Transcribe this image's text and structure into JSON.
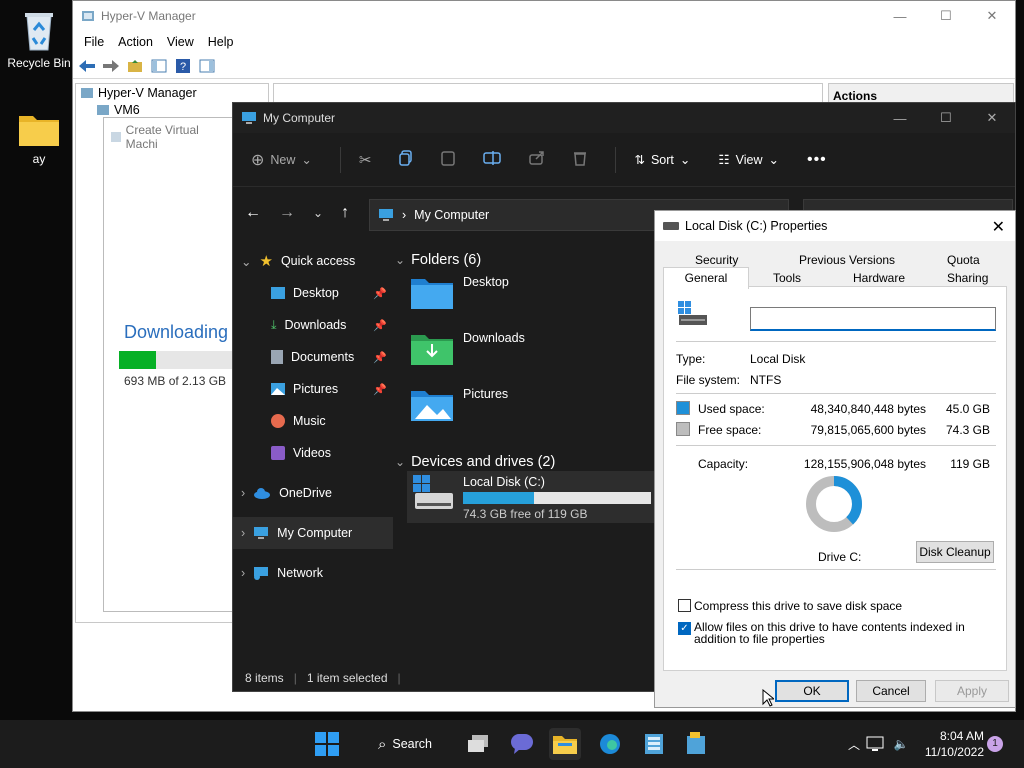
{
  "desktop": {
    "icons": [
      {
        "label": "Recycle Bin"
      },
      {
        "label": "ay"
      }
    ]
  },
  "hyperv": {
    "title": "Hyper-V Manager",
    "menu": [
      "File",
      "Action",
      "View",
      "Help"
    ],
    "tree": {
      "root": "Hyper-V Manager",
      "vm": "VM6"
    },
    "actions_header": "Actions",
    "wizard": {
      "title": "Create Virtual Machi",
      "status": "Downloading",
      "progress": 0.32,
      "size": "693 MB of 2.13 GB"
    }
  },
  "explorer": {
    "title": "My Computer",
    "commands": {
      "new": "New",
      "sort": "Sort",
      "view": "View"
    },
    "address": "My Computer",
    "nav": {
      "quick_access": "Quick access",
      "items": [
        "Desktop",
        "Downloads",
        "Documents",
        "Pictures",
        "Music",
        "Videos"
      ],
      "onedrive": "OneDrive",
      "my_computer": "My Computer",
      "network": "Network"
    },
    "folders_header": "Folders (6)",
    "folders": [
      "Desktop",
      "Downloads",
      "Pictures"
    ],
    "drives_header": "Devices and drives (2)",
    "drive": {
      "name": "Local Disk (C:)",
      "free": "74.3 GB free of 119 GB",
      "used_fraction": 0.38
    },
    "status": {
      "count": "8 items",
      "selected": "1 item selected"
    }
  },
  "properties": {
    "title": "Local Disk (C:) Properties",
    "tabs_row1": [
      "Security",
      "Previous Versions",
      "Quota"
    ],
    "tabs_row2": [
      "General",
      "Tools",
      "Hardware",
      "Sharing"
    ],
    "name_value": "",
    "type_label": "Type:",
    "type_value": "Local Disk",
    "fs_label": "File system:",
    "fs_value": "NTFS",
    "used_label": "Used space:",
    "used_bytes": "48,340,840,448 bytes",
    "used_gb": "45.0 GB",
    "free_label": "Free space:",
    "free_bytes": "79,815,065,600 bytes",
    "free_gb": "74.3 GB",
    "capacity_label": "Capacity:",
    "capacity_bytes": "128,155,906,048 bytes",
    "capacity_gb": "119 GB",
    "drive_label": "Drive C:",
    "cleanup": "Disk Cleanup",
    "compress_label": "Compress this drive to save disk space",
    "compress_checked": false,
    "index_label": "Allow files on this drive to have contents indexed in addition to file properties",
    "index_checked": true,
    "ok": "OK",
    "cancel": "Cancel",
    "apply": "Apply",
    "colors": {
      "used": "#1e90d8",
      "free": "#bdbdbd"
    }
  },
  "taskbar": {
    "search": "Search",
    "time": "8:04 AM",
    "date": "11/10/2022",
    "badge": "1"
  }
}
